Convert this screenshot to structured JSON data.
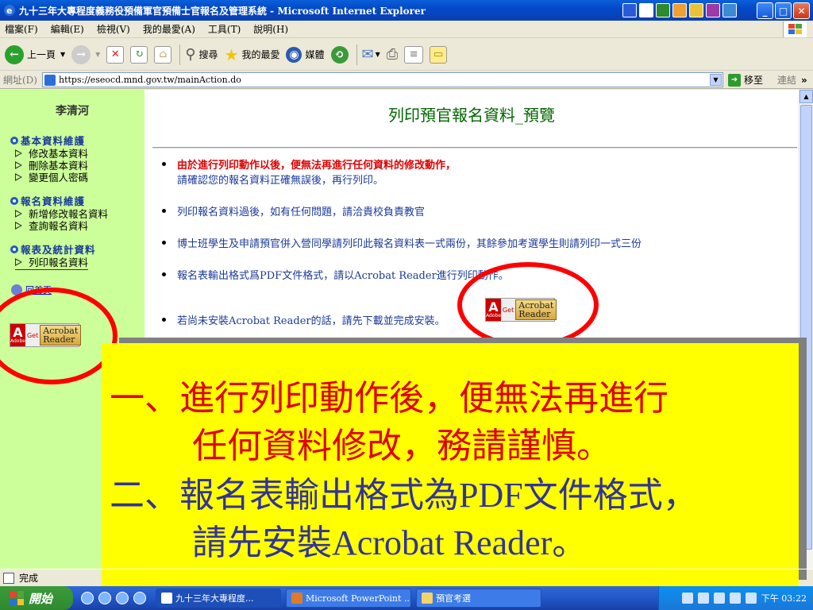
{
  "window": {
    "title": "九十三年大專程度義務役預備軍官預備士官報名及管理系統 - Microsoft Internet Explorer",
    "min_glyph": "_",
    "max_glyph": "□",
    "close_glyph": "✕"
  },
  "menu": [
    "檔案(F)",
    "編輯(E)",
    "檢視(V)",
    "我的最愛(A)",
    "工具(T)",
    "說明(H)"
  ],
  "toolbar": {
    "back_label": "上一頁",
    "search_label": "搜尋",
    "favorites_label": "我的最愛",
    "media_label": "媒體"
  },
  "address": {
    "label": "網址(D)",
    "url": "https://eseocd.mnd.gov.tw/mainAction.do",
    "go_label": "移至",
    "links_label": "連結"
  },
  "sidebar": {
    "user_name": "李清河",
    "sections": [
      {
        "title": "基本資料維護",
        "items": [
          "修改基本資料",
          "刪除基本資料",
          "變更個人密碼"
        ]
      },
      {
        "title": "報名資料維護",
        "items": [
          "新增修改報名資料",
          "查詢報名資料"
        ]
      },
      {
        "title": "報表及統計資料",
        "items": [
          "列印報名資料"
        ]
      }
    ],
    "links": [
      "回首頁"
    ],
    "acrobat_get": "Get",
    "acrobat_text": "Acrobat Reader"
  },
  "main": {
    "title": "列印預官報名資料_預覽",
    "notes": [
      {
        "red": "由於進行列印動作以後，便無法再進行任何資料的修改動作，",
        "text": "請確認您的報名資料正確無誤後，再行列印。"
      },
      {
        "red": "",
        "text": "列印報名資料過後，如有任何問題，請洽貴校負責教官"
      },
      {
        "red": "",
        "text": "博士班學生及申請預官併入營同學請列印此報名資料表一式兩份，其餘參加考選學生則請列印一式三份"
      },
      {
        "red": "",
        "text": "報名表輸出格式爲PDF文件格式，請以Acrobat Reader進行列印動作。"
      },
      {
        "red": "",
        "text": "若尚未安裝Acrobat Reader的話，請先下載並完成安裝。"
      }
    ]
  },
  "overlay": {
    "line1_num": "一、",
    "line1": "進行列印動作後，便無法再進行",
    "line2": "任何資料修改，務請謹慎。",
    "line3_num": "二、",
    "line3": "報名表輸出格式為PDF文件格式，",
    "line4": "請先安裝Acrobat Reader。"
  },
  "status": {
    "text": "完成"
  },
  "taskbar": {
    "start_label": "開始",
    "tasks": [
      "九十三年大專程度...",
      "Microsoft PowerPoint ...",
      "預官考選"
    ],
    "clock": "下午 03:22"
  },
  "colors": {
    "sidebar_bg": "#ccff99",
    "title_green": "#006600",
    "overlay_bg": "#ffff00",
    "ring_red": "#ff0000"
  }
}
